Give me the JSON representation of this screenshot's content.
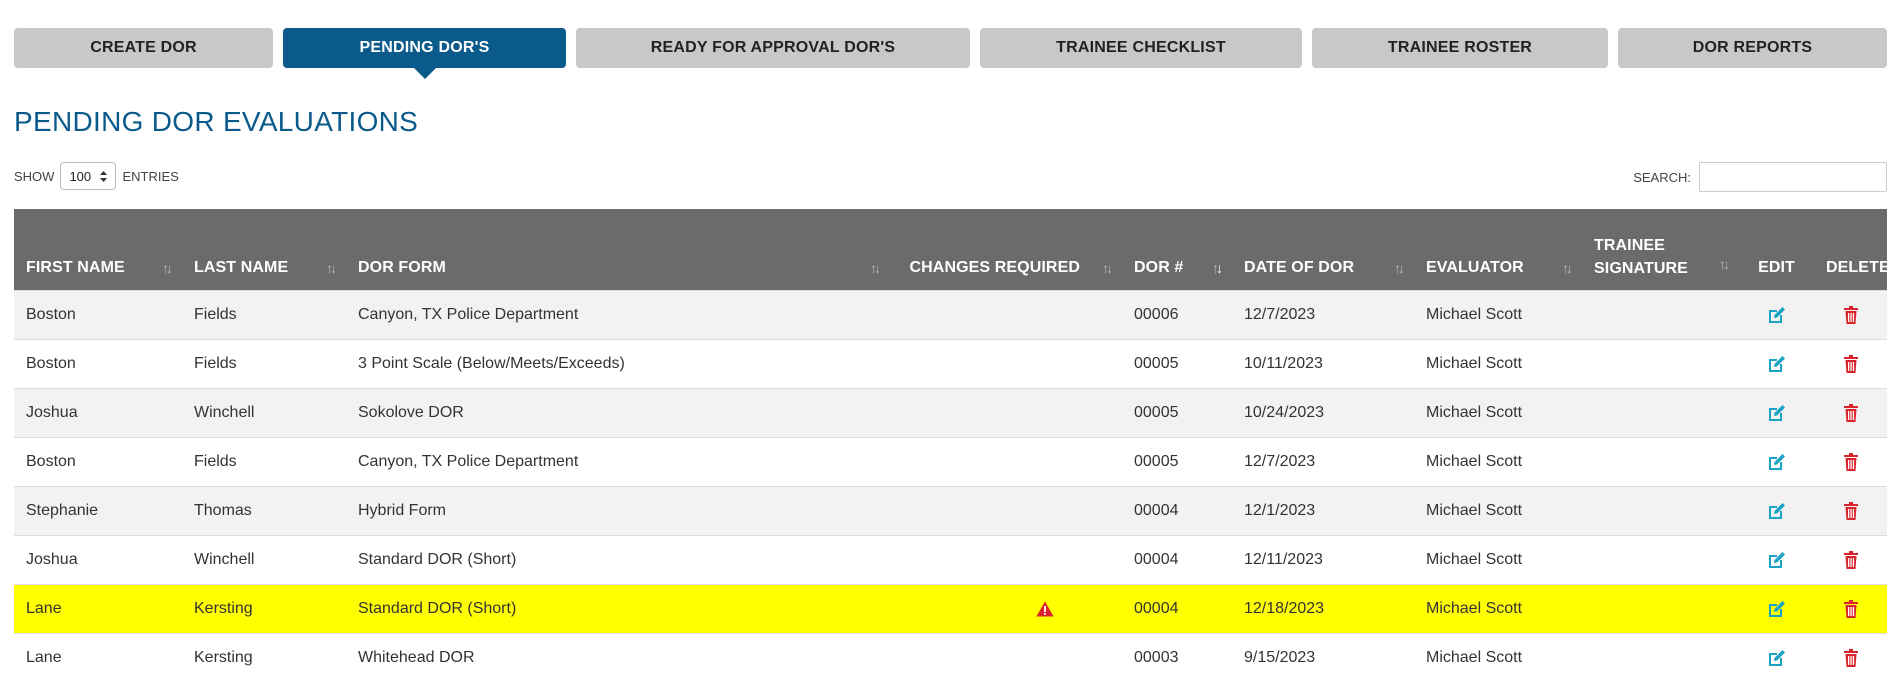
{
  "tabs": [
    {
      "label": "CREATE DOR",
      "active": false
    },
    {
      "label": "PENDING DOR'S",
      "active": true
    },
    {
      "label": "READY FOR APPROVAL DOR'S",
      "active": false
    },
    {
      "label": "TRAINEE CHECKLIST",
      "active": false
    },
    {
      "label": "TRAINEE ROSTER",
      "active": false
    },
    {
      "label": "DOR REPORTS",
      "active": false
    }
  ],
  "page_title": "PENDING DOR EVALUATIONS",
  "show_entries": {
    "show_label": "SHOW",
    "value": "100",
    "entries_label": "ENTRIES"
  },
  "search": {
    "label": "SEARCH:",
    "value": ""
  },
  "table": {
    "columns": {
      "first_name": "FIRST NAME",
      "last_name": "LAST NAME",
      "dor_form": "DOR FORM",
      "changes_required": "CHANGES REQUIRED",
      "dor_number": "DOR #",
      "date_of_dor": "DATE OF DOR",
      "evaluator": "EVALUATOR",
      "trainee_signature": "TRAINEE SIGNATURE",
      "edit": "EDIT",
      "delete": "DELETE"
    },
    "rows": [
      {
        "first_name": "Boston",
        "last_name": "Fields",
        "dor_form": "Canyon, TX Police Department",
        "changes_required": false,
        "dor_number": "00006",
        "date_of_dor": "12/7/2023",
        "evaluator": "Michael Scott",
        "trainee_signature": "",
        "highlighted": false
      },
      {
        "first_name": "Boston",
        "last_name": "Fields",
        "dor_form": "3 Point Scale (Below/Meets/Exceeds)",
        "changes_required": false,
        "dor_number": "00005",
        "date_of_dor": "10/11/2023",
        "evaluator": "Michael Scott",
        "trainee_signature": "",
        "highlighted": false
      },
      {
        "first_name": "Joshua",
        "last_name": "Winchell",
        "dor_form": "Sokolove DOR",
        "changes_required": false,
        "dor_number": "00005",
        "date_of_dor": "10/24/2023",
        "evaluator": "Michael Scott",
        "trainee_signature": "",
        "highlighted": false
      },
      {
        "first_name": "Boston",
        "last_name": "Fields",
        "dor_form": "Canyon, TX Police Department",
        "changes_required": false,
        "dor_number": "00005",
        "date_of_dor": "12/7/2023",
        "evaluator": "Michael Scott",
        "trainee_signature": "",
        "highlighted": false
      },
      {
        "first_name": "Stephanie",
        "last_name": "Thomas",
        "dor_form": "Hybrid Form",
        "changes_required": false,
        "dor_number": "00004",
        "date_of_dor": "12/1/2023",
        "evaluator": "Michael Scott",
        "trainee_signature": "",
        "highlighted": false
      },
      {
        "first_name": "Joshua",
        "last_name": "Winchell",
        "dor_form": "Standard DOR (Short)",
        "changes_required": false,
        "dor_number": "00004",
        "date_of_dor": "12/11/2023",
        "evaluator": "Michael Scott",
        "trainee_signature": "",
        "highlighted": false
      },
      {
        "first_name": "Lane",
        "last_name": "Kersting",
        "dor_form": "Standard DOR (Short)",
        "changes_required": true,
        "dor_number": "00004",
        "date_of_dor": "12/18/2023",
        "evaluator": "Michael Scott",
        "trainee_signature": "",
        "highlighted": true
      },
      {
        "first_name": "Lane",
        "last_name": "Kersting",
        "dor_form": "Whitehead DOR",
        "changes_required": false,
        "dor_number": "00003",
        "date_of_dor": "9/15/2023",
        "evaluator": "Michael Scott",
        "trainee_signature": "",
        "highlighted": false
      }
    ]
  },
  "icons": {
    "edit": "edit-icon",
    "delete": "trash-icon",
    "warning": "warning-triangle-icon",
    "sort": "sort-arrows-icon"
  },
  "colors": {
    "accent": "#0b5a8c",
    "tab_inactive": "#c8c8c8",
    "header_bg": "#6b6b6b",
    "highlight": "#ffff00",
    "edit_icon": "#1ba3c6",
    "delete_icon": "#d9232d",
    "warning_icon": "#d9232d"
  }
}
